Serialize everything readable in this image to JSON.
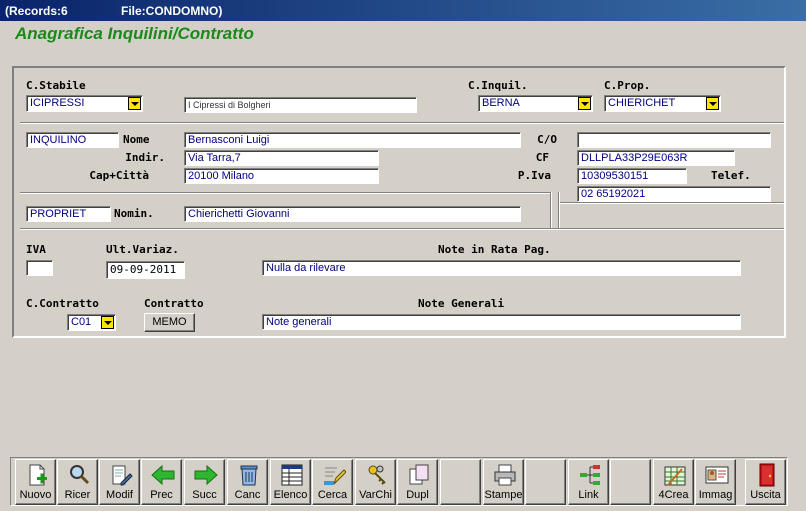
{
  "window": {
    "records": "(Records:6",
    "file": "File:CONDOMNO)"
  },
  "heading": "Anagrafica Inquilini/Contratto",
  "top": {
    "stabile_label": "C.Stabile",
    "stabile_code": "ICIPRESSI",
    "stabile_name": "I Cipressi di Bolgheri",
    "inquil_label": "C.Inquil.",
    "inquil_code": "BERNA",
    "prop_label": "C.Prop.",
    "prop_code": "CHIERICHET"
  },
  "tenant": {
    "code": "INQUILINO",
    "nome_label": "Nome",
    "nome": "Bernasconi Luigi",
    "indir_label": "Indir.",
    "indir": "Via Tarra,7",
    "cap_label": "Cap+Città",
    "cap": "20100 Milano",
    "co_label": "C/O",
    "co": "",
    "cf_label": "CF",
    "cf": "DLLPLA33P29E063R",
    "piva_label": "P.Iva",
    "piva": "10309530151",
    "telef_label": "Telef.",
    "telef": "02 65192021"
  },
  "owner": {
    "code": "PROPRIET",
    "nomin_label": "Nomin.",
    "nomin": "Chierichetti Giovanni"
  },
  "rata": {
    "iva_label": "IVA",
    "iva": "",
    "var_label": "Ult.Variaz.",
    "var": "09-09-2011",
    "note_label": "Note in Rata Pag.",
    "note": "Nulla da rilevare"
  },
  "contratto": {
    "code_label": "C.Contratto",
    "code": "C01",
    "label": "Contratto",
    "memo": "MEMO",
    "note_label": "Note Generali",
    "note": "Note generali"
  },
  "toolbar": [
    "Nuovo",
    "Ricer",
    "Modif",
    "Prec",
    "Succ",
    "Canc",
    "Elenco",
    "Cerca",
    "VarChi",
    "Dupl",
    "",
    "Stampe",
    "",
    "Link",
    "",
    "4Crea",
    "Immag",
    "Uscita"
  ],
  "colors": {
    "heading": "#1a8a1a",
    "field_text": "#000080",
    "combo_arrow": "#ffe600",
    "titlebar": "#0a246a"
  }
}
